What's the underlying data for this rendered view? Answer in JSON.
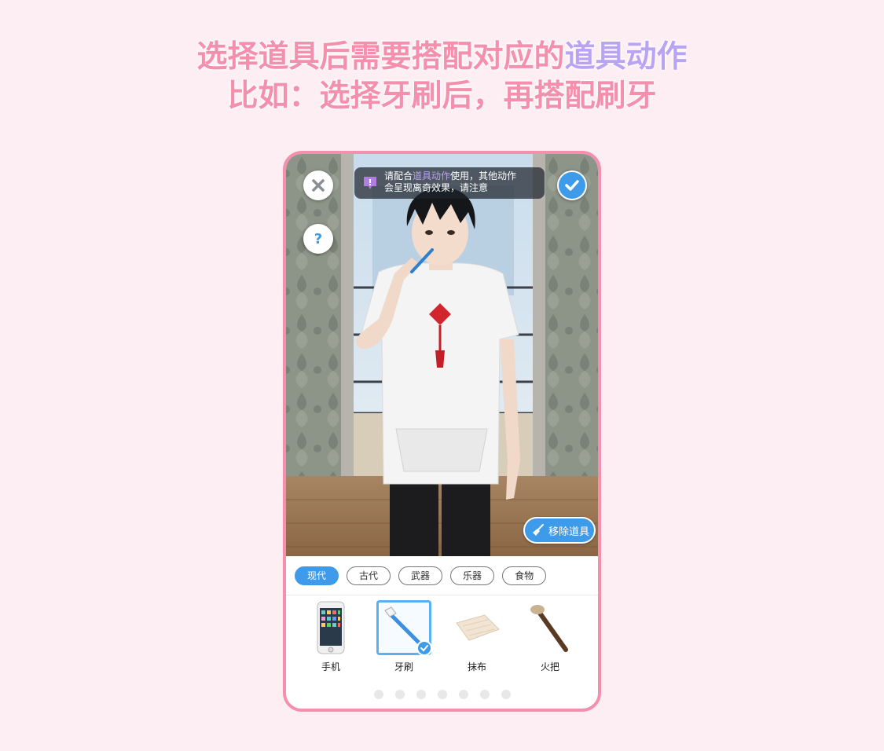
{
  "headline": {
    "line1_prefix": "选择道具后需要搭配对应的",
    "line1_accent": "道具动作",
    "line2": "比如：选择牙刷后，再搭配刷牙"
  },
  "notice": {
    "prefix": "请配合",
    "highlight": "道具动作",
    "suffix": "使用，其他动作",
    "line2": "会呈现离奇效果，请注意"
  },
  "buttons": {
    "help_label": "?",
    "remove_label": "移除道具"
  },
  "categories": [
    {
      "label": "现代",
      "active": true
    },
    {
      "label": "古代",
      "active": false
    },
    {
      "label": "武器",
      "active": false
    },
    {
      "label": "乐器",
      "active": false
    },
    {
      "label": "食物",
      "active": false
    }
  ],
  "items": [
    {
      "name": "手机",
      "icon": "phone-icon",
      "selected": false
    },
    {
      "name": "牙刷",
      "icon": "toothbrush-icon",
      "selected": true
    },
    {
      "name": "抹布",
      "icon": "cloth-icon",
      "selected": false
    },
    {
      "name": "火把",
      "icon": "torch-icon",
      "selected": false
    }
  ],
  "pagination": {
    "pages": 7,
    "current": 1
  },
  "colors": {
    "pink": "#f48fae",
    "lavender": "#b9a3f3",
    "blue": "#3d9be9",
    "background": "#fdeef4"
  }
}
